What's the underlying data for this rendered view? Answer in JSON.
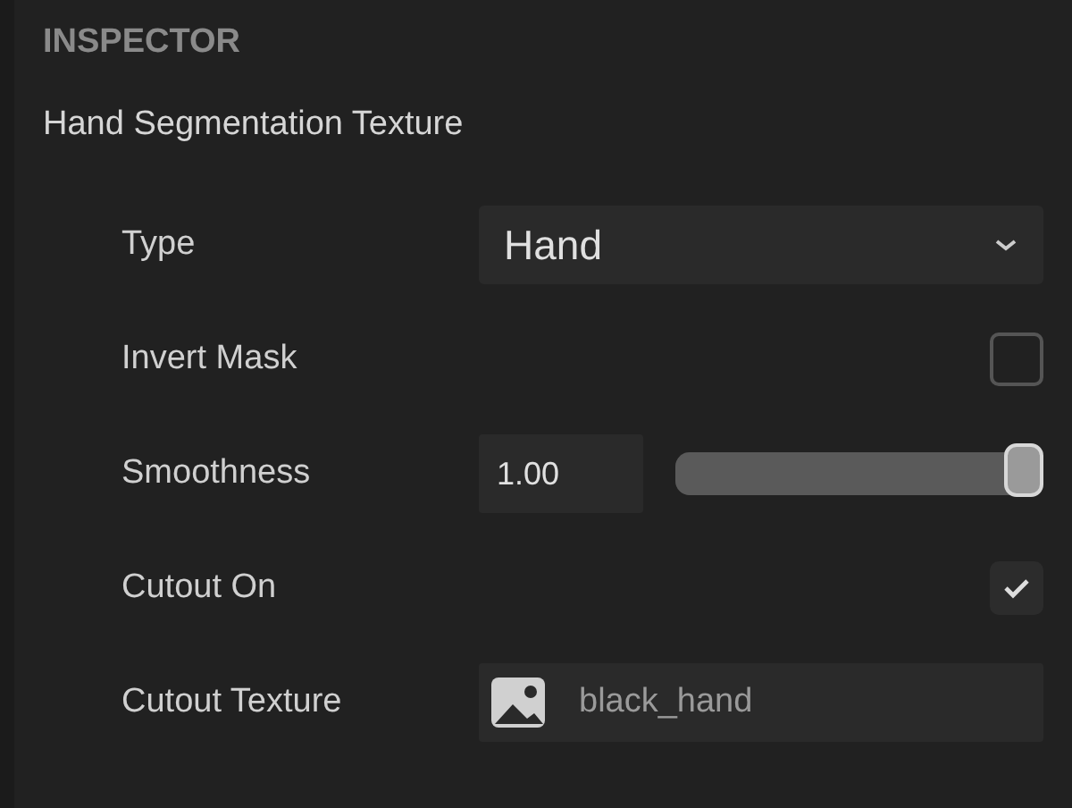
{
  "panel": {
    "title": "INSPECTOR",
    "component": "Hand Segmentation Texture"
  },
  "properties": [
    {
      "kind": "dropdown",
      "label": "Type",
      "value": "Hand"
    },
    {
      "kind": "checkbox",
      "label": "Invert Mask",
      "checked": false
    },
    {
      "kind": "slider",
      "label": "Smoothness",
      "value": "1.00",
      "level": 1
    },
    {
      "kind": "checkbox",
      "label": "Cutout On",
      "checked": true
    },
    {
      "kind": "texture",
      "label": "Cutout Texture",
      "value": "black_hand"
    }
  ]
}
